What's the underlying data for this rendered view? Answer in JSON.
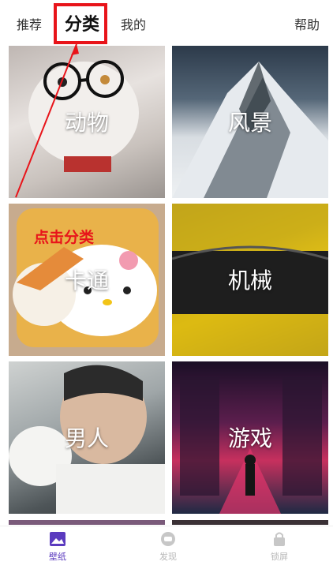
{
  "tabs": {
    "recommend": "推荐",
    "category": "分类",
    "mine": "我的",
    "help": "帮助"
  },
  "categories": [
    {
      "label": "动物"
    },
    {
      "label": "风景"
    },
    {
      "label": "卡通"
    },
    {
      "label": "机械"
    },
    {
      "label": "男人"
    },
    {
      "label": "游戏"
    }
  ],
  "annotation": {
    "text": "点击分类",
    "color": "#e8141a"
  },
  "bottom_nav": [
    {
      "label": "壁纸",
      "icon": "wallpaper-icon",
      "active": true
    },
    {
      "label": "发现",
      "icon": "discover-icon",
      "active": false
    },
    {
      "label": "锁屏",
      "icon": "lock-icon",
      "active": false
    }
  ],
  "colors": {
    "accent": "#5b3bbf",
    "annotation": "#e8141a",
    "inactive": "#b7b7b7"
  }
}
